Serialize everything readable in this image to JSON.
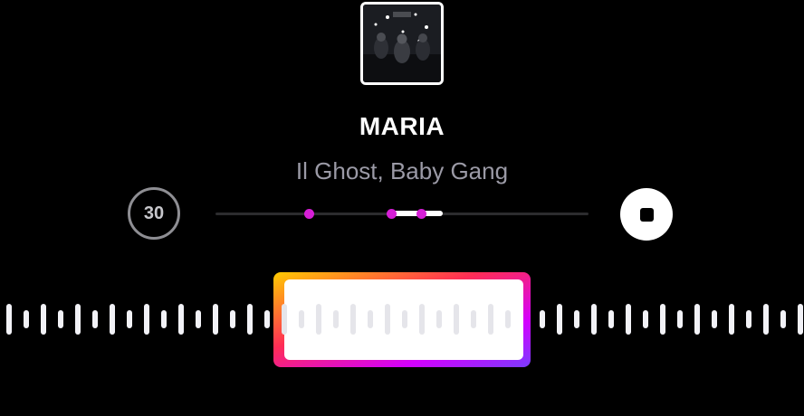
{
  "track": {
    "title": "MARIA",
    "artists": "Il Ghost, Baby Gang",
    "album_art": "album-cover-image"
  },
  "controls": {
    "rewind_label": "30",
    "stop_icon": "stop-icon"
  },
  "scrubber": {
    "track_color": "#2c2c2e",
    "marker_color": "#d61fd6",
    "selection_color": "#ffffff",
    "markers": [
      0.25,
      0.47,
      0.55
    ],
    "selection": {
      "start": 0.47,
      "end": 0.61
    }
  },
  "waveform": {
    "bar_color": "#f2f2f7",
    "inner_bar_color": "#e5e5ea",
    "selection_gradient": [
      "#ffcc00",
      "#ff2d55",
      "#d400ff",
      "#7a3cff"
    ],
    "selection_fill": "#ffffff"
  }
}
